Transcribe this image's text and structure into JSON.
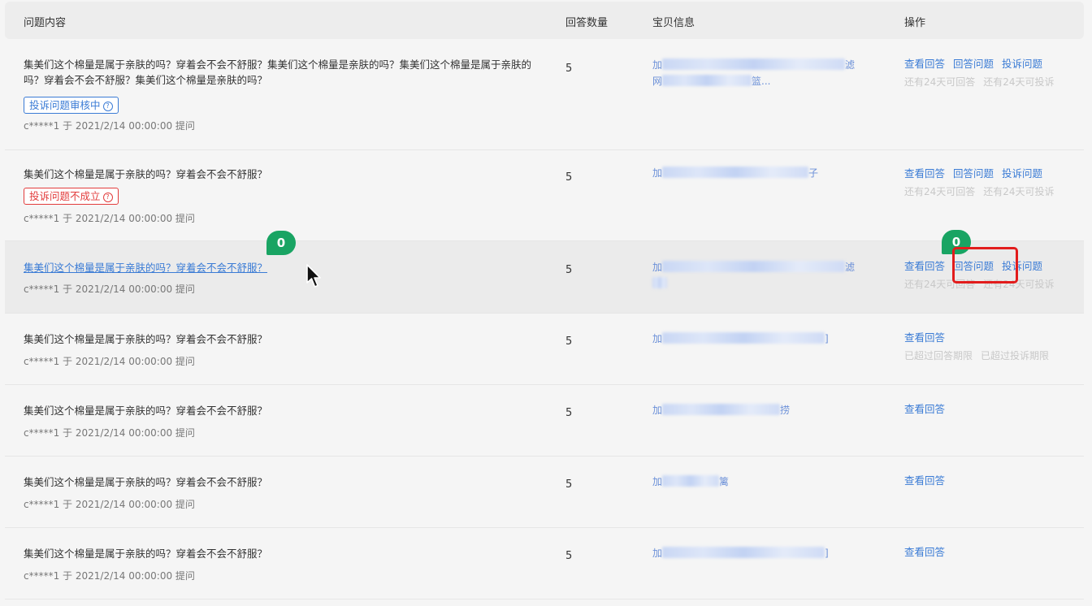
{
  "header": {
    "question_col": "问题内容",
    "count_col": "回答数量",
    "product_col": "宝贝信息",
    "ops_col": "操作"
  },
  "rows": [
    {
      "question": "集美们这个棉量是属于亲肤的吗？穿着会不会不舒服？集美们这个棉量是亲肤的吗？集美们这个棉量是属于亲肤的吗？穿着会不会不舒服？集美们这个棉量是亲肤的吗？",
      "tag": "投诉问题审核中",
      "meta": "c*****1  于 2021/2/14 00:00:00 提问",
      "count": "5",
      "product_line1_start": "加",
      "product_line1_end": "滤",
      "product_line2_start": "网",
      "product_line2_end": "篮...",
      "ops": [
        "查看回答",
        "回答问题",
        "投诉问题"
      ],
      "hints": [
        "还有24天可回答",
        "还有24天可投诉"
      ]
    },
    {
      "question": "集美们这个棉量是属于亲肤的吗？穿着会不会不舒服？",
      "tag": "投诉问题不成立",
      "meta": "c*****1  于 2021/2/14 00:00:00 提问",
      "count": "5",
      "product_line1_start": "加",
      "product_line1_end": "子",
      "ops": [
        "查看回答",
        "回答问题",
        "投诉问题"
      ],
      "hints": [
        "还有24天可回答",
        "还有24天可投诉"
      ]
    },
    {
      "question": "集美们这个棉量是属于亲肤的吗？穿着会不会不舒服？",
      "meta": "c*****1  于 2021/2/14 00:00:00 提问",
      "count": "5",
      "product_line1_start": "加",
      "product_line1_end": "滤",
      "ops": [
        "查看回答",
        "回答问题",
        "投诉问题"
      ],
      "hints": [
        "还有24天可回答",
        "还有24天可投诉"
      ],
      "badge_left": "0",
      "badge_right": "0"
    },
    {
      "question": "集美们这个棉量是属于亲肤的吗？穿着会不会不舒服？",
      "meta": "c*****1  于 2021/2/14 00:00:00 提问",
      "count": "5",
      "product_line1_start": "加",
      "product_line1_end": "]",
      "ops": [
        "查看回答"
      ],
      "hints": [
        "已超过回答期限",
        "已超过投诉期限"
      ]
    },
    {
      "question": "集美们这个棉量是属于亲肤的吗？穿着会不会不舒服？",
      "meta": "c*****1  于 2021/2/14 00:00:00 提问",
      "count": "5",
      "product_line1_start": "加",
      "product_line1_end": "捞",
      "ops": [
        "查看回答"
      ]
    },
    {
      "question": "集美们这个棉量是属于亲肤的吗？穿着会不会不舒服？",
      "meta": "c*****1  于 2021/2/14 00:00:00 提问",
      "count": "5",
      "product_line1_start": "加",
      "product_line1_end": "篱",
      "ops": [
        "查看回答"
      ]
    },
    {
      "question": "集美们这个棉量是属于亲肤的吗？穿着会不会不舒服？",
      "meta": "c*****1  于 2021/2/14 00:00:00 提问",
      "count": "5",
      "product_line1_start": "加",
      "product_line1_end": "]",
      "ops": [
        "查看回答"
      ]
    }
  ],
  "colors": {
    "link": "#3a7bd5",
    "badge": "#19a463",
    "highlight": "#e21c1c"
  },
  "icons": {
    "cursor": "arrow-cursor-icon",
    "help": "question-circle-icon"
  }
}
